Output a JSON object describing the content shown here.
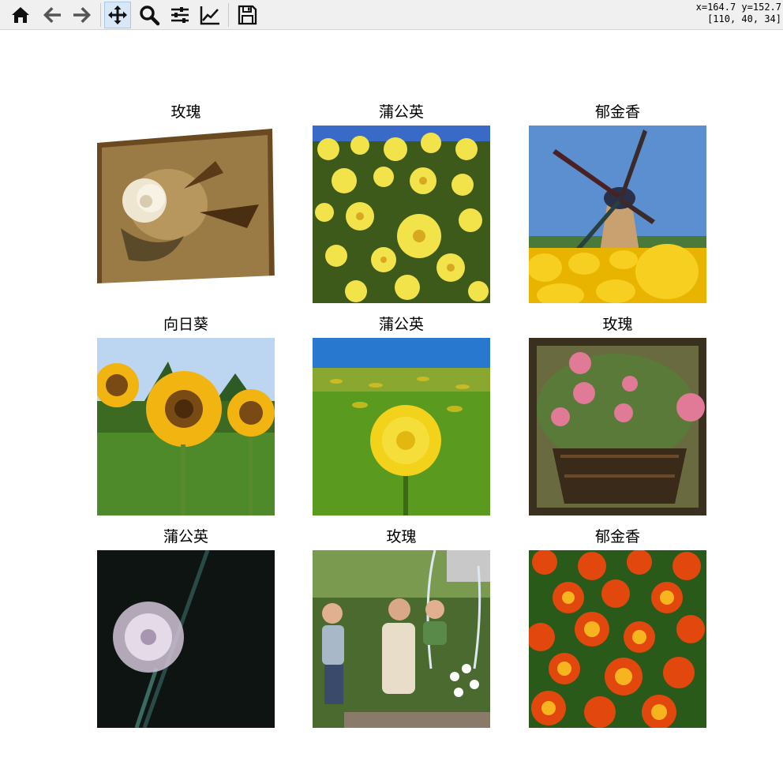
{
  "toolbar": {
    "buttons": [
      {
        "icon": "home-icon",
        "label": "Home"
      },
      {
        "icon": "back-icon",
        "label": "Back"
      },
      {
        "icon": "forward-icon",
        "label": "Forward"
      },
      {
        "icon": "pan-icon",
        "label": "Pan"
      },
      {
        "icon": "zoom-icon",
        "label": "Zoom"
      },
      {
        "icon": "subplots-icon",
        "label": "Configure subplots"
      },
      {
        "icon": "axes-icon",
        "label": "Edit axis"
      },
      {
        "icon": "save-icon",
        "label": "Save"
      }
    ],
    "active": "pan-icon"
  },
  "status": {
    "coords": "x=164.7 y=152.7",
    "pixel": "[110, 40, 34]"
  },
  "panels": [
    {
      "title": "玫瑰",
      "image": "rose-photo-vintage"
    },
    {
      "title": "蒲公英",
      "image": "yellow-daisy-field-photo"
    },
    {
      "title": "郁金香",
      "image": "windmill-tulip-photo"
    },
    {
      "title": "向日葵",
      "image": "sunflower-field-photo"
    },
    {
      "title": "蒲公英",
      "image": "dandelion-meadow-photo"
    },
    {
      "title": "玫瑰",
      "image": "rose-basket-photo"
    },
    {
      "title": "蒲公英",
      "image": "dandelion-seedhead-photo"
    },
    {
      "title": "玫瑰",
      "image": "family-fountain-photo"
    },
    {
      "title": "郁金香",
      "image": "orange-tulips-photo"
    }
  ]
}
